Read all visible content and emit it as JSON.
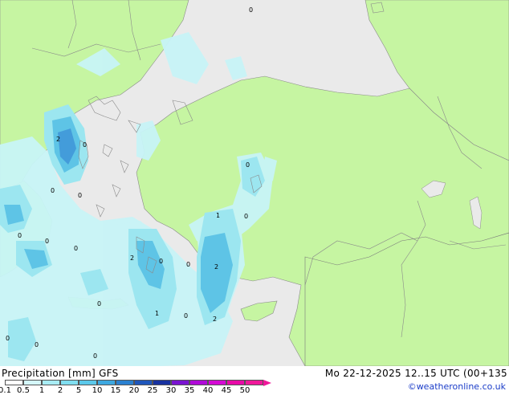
{
  "map": {
    "contour_labels": [
      "2",
      "0",
      "0",
      "0",
      "0",
      "0",
      "0",
      "0",
      "1",
      "0",
      "2",
      "0",
      "2",
      "1",
      "0",
      "2",
      "0",
      "0",
      "0",
      "0",
      "0",
      "0"
    ],
    "colors": {
      "sea": "#eaeaea",
      "land": "#c6f5a2",
      "precip_light": "#c8f4f7",
      "precip_mid": "#9ce6f0",
      "precip_heavy": "#5ec4e6",
      "precip_core": "#3b8fd6",
      "border": "#8a8a8a"
    }
  },
  "footer": {
    "title": "Precipitation [mm] GFS",
    "valid_time": "Mo 22-12-2025 12..15 UTC (00+135",
    "credit": "©weatheronline.co.uk"
  },
  "legend": {
    "ticks": [
      "0.1",
      "0.5",
      "1",
      "2",
      "5",
      "10",
      "15",
      "20",
      "25",
      "30",
      "35",
      "40",
      "45",
      "50"
    ],
    "colors": [
      "#ffffff",
      "#d4f7fb",
      "#a8ecf4",
      "#80def0",
      "#5cc8ea",
      "#3da8e0",
      "#2a80d0",
      "#1f56bb",
      "#1832a0",
      "#7a14d0",
      "#b00ad8",
      "#d40ad4",
      "#e80aa8",
      "#f0189a"
    ]
  }
}
